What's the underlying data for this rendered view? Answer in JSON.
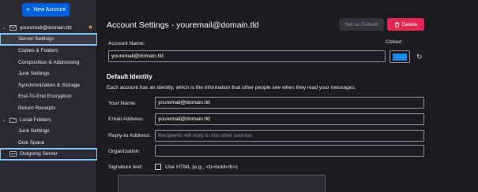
{
  "sidebar": {
    "new_account_label": "New Account",
    "account": {
      "name": "youremail@domain.tld"
    },
    "account_items": [
      "Server Settings",
      "Copies & Folders",
      "Composition & Addressing",
      "Junk Settings",
      "Synchronization & Storage",
      "End-To-End Encryption",
      "Return Receipts"
    ],
    "local_folders": {
      "name": "Local Folders",
      "items": [
        "Junk Settings",
        "Disk Space"
      ]
    },
    "outgoing_server": "Outgoing Server"
  },
  "main": {
    "title": "Account Settings - youremail@domain.tld",
    "set_default_label": "Set as Default",
    "delete_label": "Delete",
    "account_name_label": "Account Name:",
    "account_name_value": "youremail@domain.tld",
    "colour_label": "Colour:",
    "colour_value": "#1e88e5",
    "default_identity_heading": "Default Identity",
    "identity_description": "Each account has an identity, which is the information that other people see when they read your messages.",
    "your_name_label": "Your Name:",
    "your_name_value": "youremail@domain.tld",
    "email_label": "Email Address:",
    "email_value": "youremail@domain.tld",
    "reply_to_label": "Reply-to Address:",
    "reply_to_placeholder": "Recipients will reply to this other address",
    "organization_label": "Organization:",
    "organization_value": "",
    "signature_label": "Signature text:",
    "use_html_label": "Use HTML (e.g., <b>bold</b>)"
  }
}
